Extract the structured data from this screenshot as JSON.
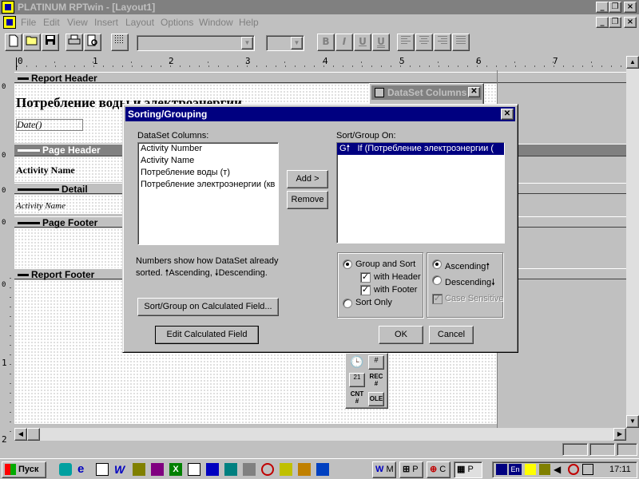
{
  "app": {
    "title": "PLATINUM RPTwin - [Layout1]"
  },
  "menu": [
    "File",
    "Edit",
    "View",
    "Insert",
    "Layout",
    "Options",
    "Window",
    "Help"
  ],
  "window_buttons": {
    "minimize": "_",
    "restore": "❐",
    "close": "×"
  },
  "toolbar": {
    "bold": "B",
    "italic": "I",
    "underline": "U",
    "doubleunderline": "U"
  },
  "ruler": {
    "marks": [
      "0",
      "1",
      "2",
      "3",
      "4",
      "5",
      "6",
      "7"
    ],
    "vmarks": [
      "0",
      "0",
      "0",
      "0",
      "0",
      "1",
      "2"
    ]
  },
  "report": {
    "bands": {
      "report_header": "Report Header",
      "page_header": "Page Header",
      "detail": "Detail",
      "page_footer": "Page Footer",
      "report_footer": "Report Footer"
    },
    "title_text": "Потребление воды и электроэнергии",
    "date_field": "Date()",
    "activity_header": "Activity Name",
    "activity_field": "Activity Name"
  },
  "dataset_palette": {
    "title": "DataSet Columns"
  },
  "tool_palette": {
    "rec_label": "REC #",
    "cnt_label": "CNT #",
    "ole_label": "OLE"
  },
  "dialog": {
    "title": "Sorting/Grouping",
    "columns_label": "DataSet Columns:",
    "columns": [
      "Activity Number",
      "Activity Name",
      "Потребление воды (т)",
      "Потребление электроэнергии (кв"
    ],
    "sortgroup_label": "Sort/Group On:",
    "sortgroup_items": [
      {
        "prefix": "G🠕",
        "text": "If (Потребление электроэнергии ("
      }
    ],
    "add_button": "Add >",
    "remove_button": "Remove",
    "note": "Numbers show how DataSet already sorted. 🠕Ascending, 🠗Descending.",
    "calc_field_button": "Sort/Group on Calculated Field...",
    "edit_calc_button": "Edit Calculated Field",
    "group_and_sort": "Group and Sort",
    "with_header": "with Header",
    "with_footer": "with Footer",
    "sort_only": "Sort Only",
    "ascending": "Ascending🠕",
    "descending": "Descending🠗",
    "case_sensitive": "Case Sensitive",
    "ok_button": "OK",
    "cancel_button": "Cancel",
    "close_glyph": "✕",
    "check_glyph": "✓"
  },
  "taskbar": {
    "start": "Пуск",
    "tasks": [
      "M",
      "P",
      "C",
      "P"
    ],
    "lang": "En",
    "time": "17:11"
  },
  "colors": {
    "titlebar_inactive": "#808080",
    "dialog_titlebar": "#000080",
    "selection": "#000080"
  }
}
